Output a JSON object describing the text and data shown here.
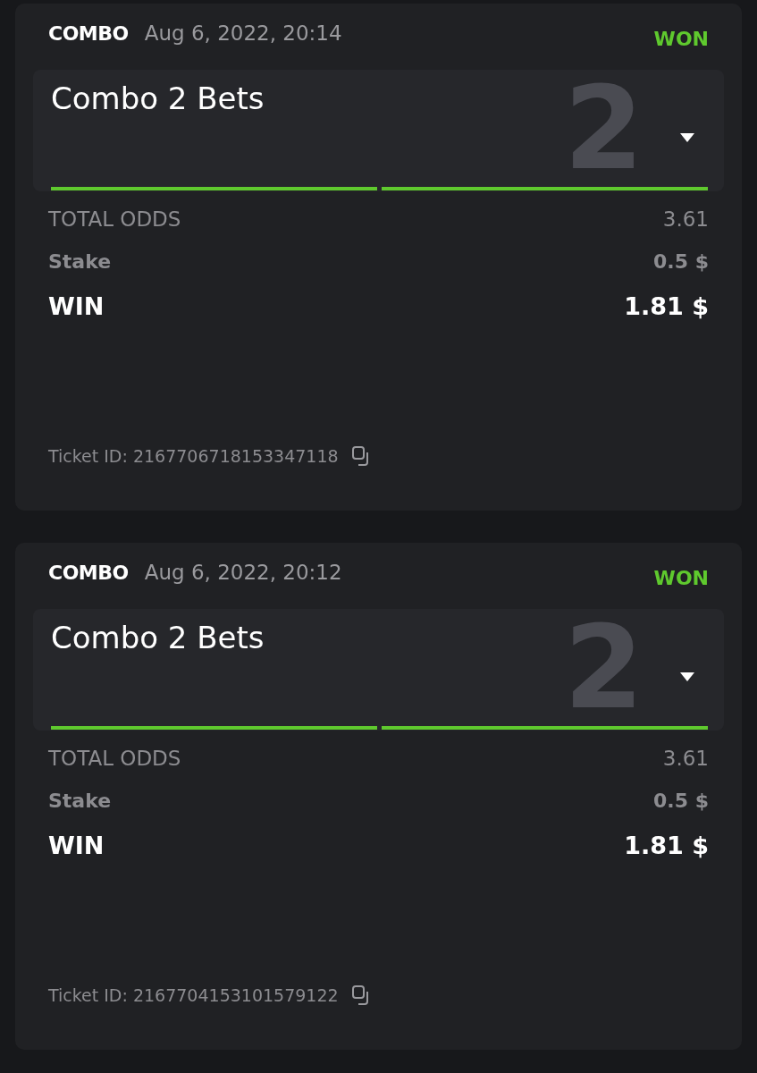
{
  "tickets": [
    {
      "type": "COMBO",
      "date": "Aug 6, 2022, 20:14",
      "status": {
        "text": "WON",
        "kind": "won"
      },
      "title": "Combo 2 Bets",
      "count": "2",
      "expanded": false,
      "legs": [
        {
          "won": true
        },
        {
          "won": true
        }
      ],
      "total_odds_label": "TOTAL ODDS",
      "total_odds": "3.61",
      "stake_label": "Stake",
      "stake": "0.5 $",
      "win_label": "WIN",
      "win": "1.81 $",
      "ticket_id": "Ticket ID: 2167706718153347118"
    },
    {
      "type": "COMBO",
      "date": "Aug 6, 2022, 20:12",
      "status": {
        "text": "WON",
        "kind": "won"
      },
      "title": "Combo 2 Bets",
      "count": "2",
      "expanded": false,
      "legs": [
        {
          "won": true
        },
        {
          "won": true
        }
      ],
      "total_odds_label": "TOTAL ODDS",
      "total_odds": "3.61",
      "stake_label": "Stake",
      "stake": "0.5 $",
      "win_label": "WIN",
      "win": "1.81 $",
      "ticket_id": "Ticket ID: 2167704153101579122"
    }
  ]
}
